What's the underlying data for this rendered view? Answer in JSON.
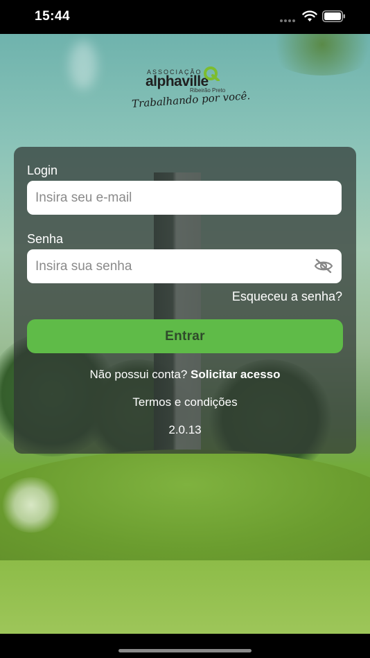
{
  "status_bar": {
    "time": "15:44"
  },
  "logo": {
    "association": "ASSOCIAÇÃO",
    "name": "alphaville",
    "subtitle": "Ribeirão Preto",
    "tagline": "Trabalhando por você."
  },
  "form": {
    "login_label": "Login",
    "email_placeholder": "Insira seu e-mail",
    "password_label": "Senha",
    "password_placeholder": "Insira sua senha",
    "forgot_password": "Esqueceu a senha?",
    "submit": "Entrar",
    "no_account": "Não possui conta?",
    "request_access": "Solicitar acesso",
    "terms": "Termos e condições",
    "version": "2.0.13"
  },
  "colors": {
    "primary_button": "#5fbb48",
    "logo_accent": "#7dbd2e",
    "card_overlay": "#303734"
  },
  "icons": [
    "wifi-icon",
    "battery-icon",
    "eye-off-icon",
    "logo-mark-icon"
  ]
}
